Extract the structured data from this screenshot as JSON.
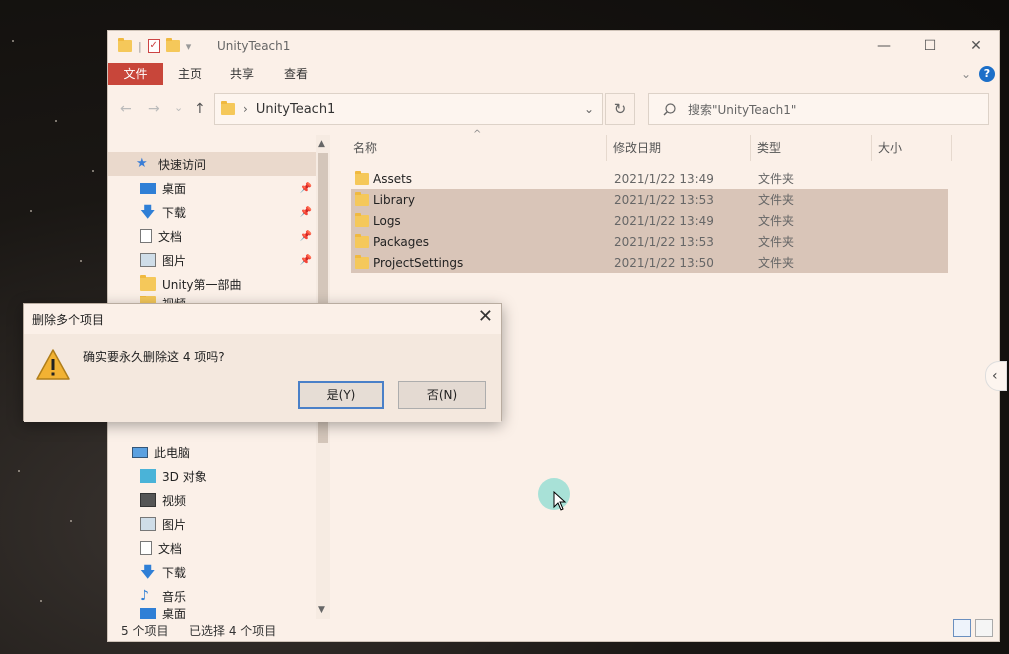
{
  "window": {
    "title": "UnityTeach1",
    "controls": {
      "minimize": "—",
      "maximize": "☐",
      "close": "✕"
    }
  },
  "ribbon": {
    "tabs": [
      "文件",
      "主页",
      "共享",
      "查看"
    ],
    "help": "?"
  },
  "navbar": {
    "back": "←",
    "forward": "→",
    "recent": "⌄",
    "up": "↑",
    "breadcrumb": "UnityTeach1",
    "refresh": "↻",
    "search_placeholder": "搜索\"UnityTeach1\""
  },
  "sidebar": {
    "quick_access": "快速访问",
    "quick_items": [
      {
        "label": "桌面",
        "icon": "desktop-icon",
        "pinned": true
      },
      {
        "label": "下载",
        "icon": "download-icon",
        "pinned": true
      },
      {
        "label": "文档",
        "icon": "document-icon",
        "pinned": true
      },
      {
        "label": "图片",
        "icon": "picture-icon",
        "pinned": true
      },
      {
        "label": "Unity第一部曲",
        "icon": "folder-icon",
        "pinned": false
      },
      {
        "label": "视频",
        "icon": "folder-icon",
        "pinned": false
      }
    ],
    "this_pc": "此电脑",
    "pc_items": [
      {
        "label": "3D 对象",
        "icon": "cube-icon"
      },
      {
        "label": "视频",
        "icon": "video-icon"
      },
      {
        "label": "图片",
        "icon": "picture-icon"
      },
      {
        "label": "文档",
        "icon": "document-icon"
      },
      {
        "label": "下载",
        "icon": "download-icon"
      },
      {
        "label": "音乐",
        "icon": "music-icon"
      },
      {
        "label": "桌面",
        "icon": "desktop-icon"
      }
    ]
  },
  "list": {
    "columns": [
      "名称",
      "修改日期",
      "类型",
      "大小"
    ],
    "rows": [
      {
        "name": "Assets",
        "date": "2021/1/22 13:49",
        "type": "文件夹",
        "selected": false
      },
      {
        "name": "Library",
        "date": "2021/1/22 13:53",
        "type": "文件夹",
        "selected": true
      },
      {
        "name": "Logs",
        "date": "2021/1/22 13:49",
        "type": "文件夹",
        "selected": true
      },
      {
        "name": "Packages",
        "date": "2021/1/22 13:53",
        "type": "文件夹",
        "selected": true
      },
      {
        "name": "ProjectSettings",
        "date": "2021/1/22 13:50",
        "type": "文件夹",
        "selected": true
      }
    ]
  },
  "status": {
    "count": "5 个项目",
    "selected": "已选择 4 个项目"
  },
  "dialog": {
    "title": "删除多个项目",
    "close": "✕",
    "message": "确实要永久删除这 4 项吗?",
    "yes": "是(Y)",
    "no": "否(N)"
  },
  "colors": {
    "window_bg": "#fbf0e8",
    "file_tab": "#c8463a",
    "selection": "#d9c5b8",
    "folder": "#f5c85a",
    "primary_button_border": "#4a80c8"
  }
}
